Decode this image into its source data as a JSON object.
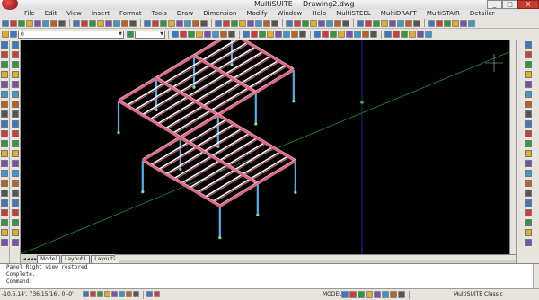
{
  "window": {
    "app_title": "MultiSUITE",
    "document_title": "Drawing2.dwg",
    "controls": [
      "_",
      "□",
      "X"
    ]
  },
  "menu": [
    "File",
    "Edit",
    "View",
    "Insert",
    "Format",
    "Tools",
    "Draw",
    "Dimension",
    "Modify",
    "Window",
    "Help",
    "MultiSTEEL",
    "MultiDRAFT",
    "MultiSTAIR",
    "Detailer"
  ],
  "toolbar": {
    "layer_value": "0",
    "current_style": "",
    "icon_colors": [
      "#3a78c8",
      "#d23b3b",
      "#2e9a3e",
      "#e0b020",
      "#7a4fb0",
      "#3a9ad0",
      "#c06020",
      "#555555"
    ]
  },
  "tabs": {
    "nav": "◂◂◂▸",
    "items": [
      "Model",
      "Layout1",
      "Layout2"
    ],
    "active": "Model"
  },
  "command": {
    "lines": [
      "Panel Right view restored",
      "Complete.",
      "Command:"
    ]
  },
  "status": {
    "coords": "-10.5.14', 736.15/16', 0'-0'",
    "model": "MODEL",
    "workspace": "MultiSUITE Classic"
  },
  "colors": {
    "canvas": "#000000",
    "beam": "#d86a86",
    "joist": "#ffffff",
    "column": "#4fb0e8",
    "axis_green": "#1f8f1f",
    "axis_blue": "#1a2a9a"
  }
}
